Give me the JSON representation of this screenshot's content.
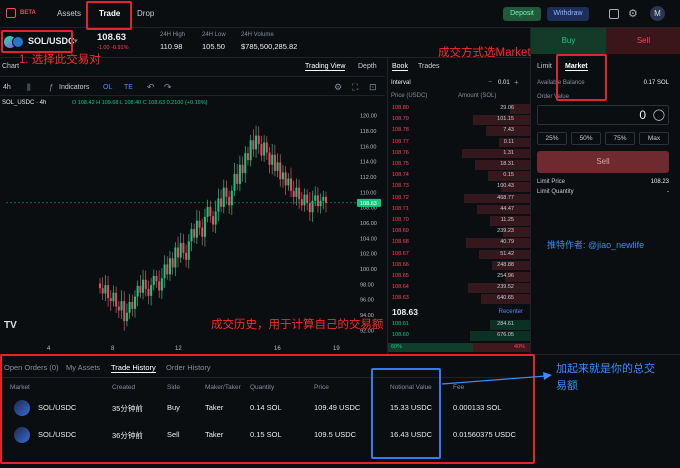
{
  "nav": {
    "beta": "BETA",
    "links": [
      "Assets",
      "Trade",
      "Drop"
    ],
    "deposit": "Deposit",
    "withdraw": "Withdraw",
    "avatar": "M"
  },
  "pair": {
    "symbol": "SOL/USDC",
    "price": "108.63",
    "change": "-1.00  -0.91%",
    "stats": [
      {
        "label": "24H High",
        "value": "110.98"
      },
      {
        "label": "24H Low",
        "value": "105.50"
      },
      {
        "label": "24H Volume",
        "value": "$785,500,285.82"
      }
    ]
  },
  "chart_header": {
    "title": "Chart",
    "tabs": [
      "Trading View",
      "Depth"
    ],
    "interval": "4h",
    "indicators": "Indicators",
    "scale_buttons": [
      "OL",
      "TE"
    ],
    "legend_symbol": "SOL_USDC · 4h",
    "legend_values": "O 108.42  H 109.68  L 108.40  C 108.63  0.2100 (+0.19%)"
  },
  "chart_data": {
    "type": "candlestick",
    "y_ticks": [
      "120.00",
      "118.00",
      "116.00",
      "114.00",
      "112.00",
      "110.00",
      "108.00",
      "106.00",
      "104.00",
      "102.00",
      "100.00",
      "98.00",
      "96.00",
      "94.00",
      "92.00"
    ],
    "ylim": [
      91,
      121
    ],
    "x_ticks": [
      "4",
      "8",
      "12",
      "16",
      "19"
    ],
    "last_price_label": "108.63",
    "closes": [
      97.5,
      96.8,
      97.9,
      96.2,
      95.8,
      96.9,
      95.1,
      94.6,
      95.8,
      93.2,
      94.3,
      95.7,
      94.8,
      96.4,
      97.8,
      96.9,
      98.6,
      97.4,
      96.5,
      97.9,
      99.1,
      98.4,
      97.2,
      98.8,
      100.6,
      99.3,
      101.4,
      100.2,
      102.8,
      101.5,
      103.4,
      102.1,
      101.2,
      103.6,
      105.2,
      104.1,
      106.3,
      105.4,
      104.2,
      106.8,
      108.1,
      106.9,
      105.8,
      107.5,
      109.2,
      108.1,
      110.6,
      109.4,
      108.3,
      110.2,
      112.4,
      111.1,
      113.6,
      112.5,
      115.1,
      114.2,
      116.8,
      115.6,
      117.4,
      116.3,
      114.8,
      116.5,
      115.2,
      113.6,
      114.9,
      112.8,
      113.9,
      111.7,
      112.6,
      110.9,
      111.8,
      110.2,
      109.4,
      110.6,
      109.1,
      108.3,
      109.7,
      108.6,
      107.4,
      108.9,
      109.6,
      108.2,
      108.9,
      109.4,
      108.63
    ]
  },
  "orderbook": {
    "tabs": [
      "Book",
      "Trades"
    ],
    "interval_label": "Interval",
    "interval_value": "0.01",
    "col_price": "Price (USDC)",
    "col_amount": "Amount (SOL)",
    "asks": [
      [
        "108.80",
        "29.06"
      ],
      [
        "108.79",
        "101.15"
      ],
      [
        "108.78",
        "7.43"
      ],
      [
        "108.77",
        "0.11"
      ],
      [
        "108.76",
        "1.31"
      ],
      [
        "108.75",
        "18.31"
      ],
      [
        "108.74",
        "0.15"
      ],
      [
        "108.73",
        "100.43"
      ],
      [
        "108.72",
        "468.77"
      ],
      [
        "108.71",
        "44.47"
      ],
      [
        "108.70",
        "11.25"
      ],
      [
        "108.69",
        "239.23"
      ],
      [
        "108.68",
        "40.79"
      ],
      [
        "108.67",
        "51.42"
      ],
      [
        "108.66",
        "248.88"
      ],
      [
        "108.65",
        "254.96"
      ],
      [
        "108.64",
        "239.52"
      ],
      [
        "108.63",
        "640.65"
      ]
    ],
    "mid_price": "108.63",
    "recenter": "Recenter",
    "bids": [
      [
        "108.61",
        "284.61"
      ],
      [
        "108.60",
        "676.05"
      ]
    ],
    "buy_ratio": "60%",
    "sell_ratio": "40%"
  },
  "trade_panel": {
    "buy": "Buy",
    "sell": "Sell",
    "order_types": [
      "Limit",
      "Market"
    ],
    "available_label": "Available Balance",
    "available_value": "0.17 SOL",
    "order_value_label": "Order Value",
    "order_value": "0",
    "percents": [
      "25%",
      "50%",
      "75%",
      "Max"
    ],
    "sell_button": "Sell",
    "limit_price_label": "Limit Price",
    "limit_price_value": "108.23",
    "limit_qty_label": "Limit Quantity",
    "limit_qty_value": "-"
  },
  "bottom": {
    "tabs": [
      "Open Orders (0)",
      "My Assets",
      "Trade History",
      "Order History"
    ],
    "headers": [
      "Market",
      "Created",
      "Side",
      "Maker/Taker",
      "Quantity",
      "Price",
      "Notional Value",
      "Fee"
    ],
    "rows": [
      {
        "market": "SOL/USDC",
        "created": "35分钟前",
        "side": "Buy",
        "maker": "Taker",
        "qty": "0.14 SOL",
        "price": "109.49 USDC",
        "notional": "15.33 USDC",
        "fee": "0.000133 SOL"
      },
      {
        "market": "SOL/USDC",
        "created": "36分钟前",
        "side": "Sell",
        "maker": "Taker",
        "qty": "0.15 SOL",
        "price": "109.5 USDC",
        "notional": "16.43 USDC",
        "fee": "0.01560375 USDC"
      }
    ]
  },
  "annotations": {
    "pair_note": "1. 选择此交易对",
    "market_note": "成交方式选Market",
    "author": "推特作者: @jiao_newlife",
    "history_note": "成交历史，用于计算自己的交易额",
    "sum_note_1": "加起来就是你的总交",
    "sum_note_2": "易额"
  }
}
